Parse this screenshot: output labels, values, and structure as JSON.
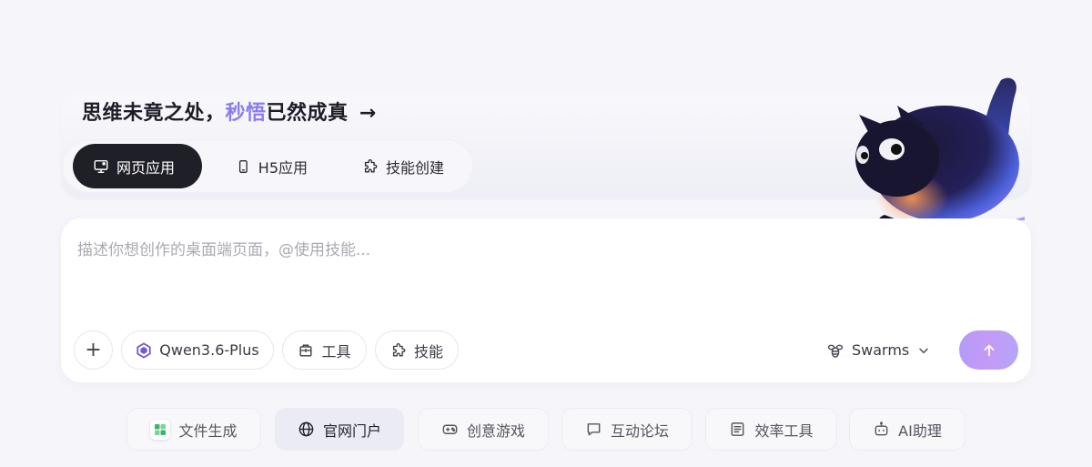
{
  "headline": {
    "prefix": "思维未竟之处，",
    "highlight": "秒悟",
    "suffix": "已然成真",
    "arrow": "→"
  },
  "mode_tabs": [
    {
      "label": "网页应用",
      "icon": "monitor-icon",
      "active": true
    },
    {
      "label": "H5应用",
      "icon": "phone-icon",
      "active": false
    },
    {
      "label": "技能创建",
      "icon": "puzzle-icon",
      "active": false
    }
  ],
  "input": {
    "placeholder": "描述你想创作的桌面端页面，@使用技能...",
    "value": ""
  },
  "toolbar": {
    "plus_label": "+",
    "model_label": "Qwen3.6-Plus",
    "tools_label": "工具",
    "skills_label": "技能",
    "swarms_label": "Swarms",
    "send_icon": "arrow-up-icon"
  },
  "categories": [
    {
      "label": "文件生成",
      "icon": "spreadsheet-icon",
      "active": false
    },
    {
      "label": "官网门户",
      "icon": "globe-icon",
      "active": true
    },
    {
      "label": "创意游戏",
      "icon": "gamepad-icon",
      "active": false
    },
    {
      "label": "互动论坛",
      "icon": "chat-bubble-icon",
      "active": false
    },
    {
      "label": "效率工具",
      "icon": "document-icon",
      "active": false
    },
    {
      "label": "AI助理",
      "icon": "robot-icon",
      "active": false
    }
  ],
  "colors": {
    "accent": "#8b7cf0",
    "active_tab_bg": "#1f1f28",
    "page_bg": "#f6f6fa",
    "send_gradient_start": "#b49bf8",
    "send_gradient_end": "#b5a5fb"
  }
}
